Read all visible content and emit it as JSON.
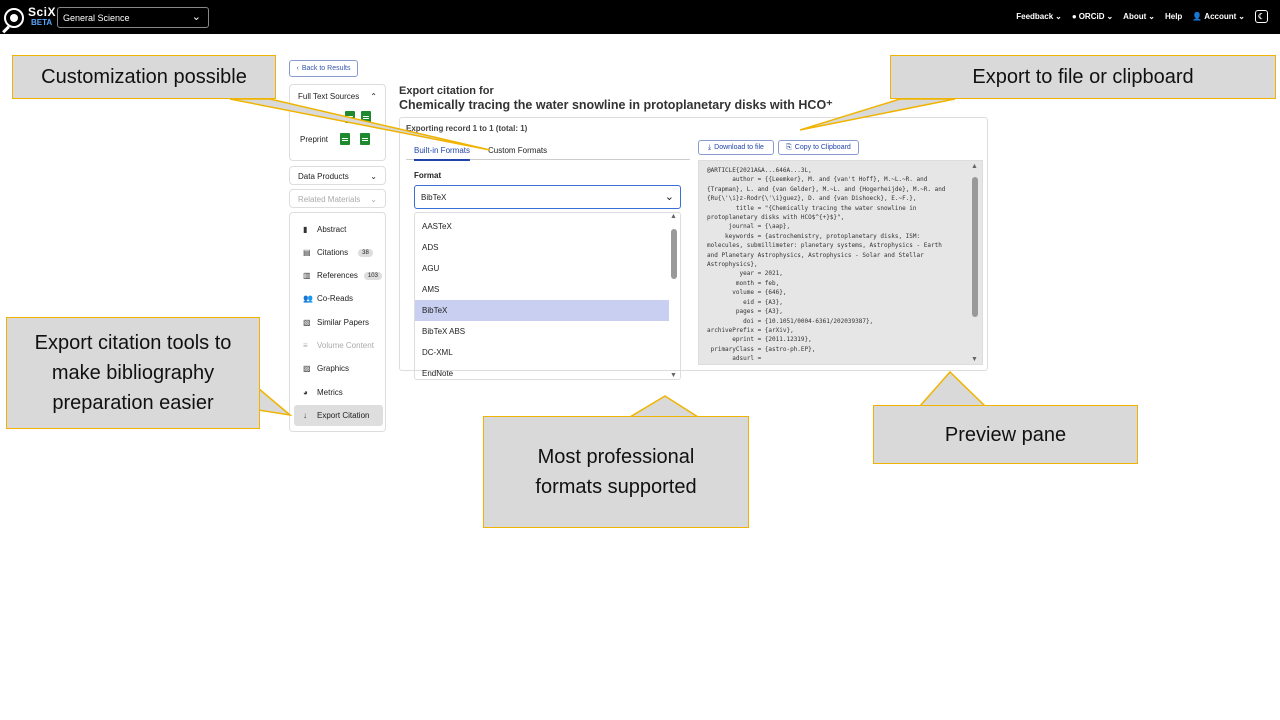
{
  "topbar": {
    "logo_text": "SciX",
    "logo_beta": "BETA",
    "discipline": "General Science",
    "nav": {
      "feedback": "Feedback",
      "orcid": "ORCiD",
      "about": "About",
      "help": "Help",
      "account": "Account"
    }
  },
  "sidebar": {
    "back_label": "Back to Results",
    "full_text_sources": "Full Text Sources",
    "preprint": "Preprint",
    "data_products": "Data Products",
    "related_materials": "Related Materials",
    "items": [
      {
        "label": "Abstract"
      },
      {
        "label": "Citations",
        "count": "38"
      },
      {
        "label": "References",
        "count": "103"
      },
      {
        "label": "Co-Reads"
      },
      {
        "label": "Similar Papers"
      },
      {
        "label": "Volume Content"
      },
      {
        "label": "Graphics"
      },
      {
        "label": "Metrics"
      },
      {
        "label": "Export Citation"
      }
    ]
  },
  "main": {
    "export_label": "Export citation for",
    "paper_title": "Chemically tracing the water snowline in protoplanetary disks with HCO⁺",
    "record_info": "Exporting record 1 to 1 (total: 1)",
    "tabs": [
      "Built-in Formats",
      "Custom Formats"
    ],
    "format_label": "Format",
    "selected_format": "BibTeX",
    "format_options": [
      "AASTeX",
      "ADS",
      "AGU",
      "AMS",
      "BibTeX",
      "BibTeX ABS",
      "DC-XML",
      "EndNote"
    ],
    "download_label": "Download to file",
    "copy_label": "Copy to Clipboard",
    "preview_text": "@ARTICLE{2021A&A...646A...3L,\n       author = {{Leemker}, M. and {van't Hoff}, M.~L.~R. and\n{Trapman}, L. and {van Gelder}, M.~L. and {Hogerheijde}, M.~R. and\n{Ru{\\'\\i}z-Rodr{\\'\\i}guez}, D. and {van Dishoeck}, E.~F.},\n        title = \"{Chemically tracing the water snowline in\nprotoplanetary disks with HCO$^{+}$}\",\n      journal = {\\aap},\n     keywords = {astrochemistry, protoplanetary disks, ISM:\nmolecules, submillimeter: planetary systems, Astrophysics - Earth\nand Planetary Astrophysics, Astrophysics - Solar and Stellar\nAstrophysics},\n         year = 2021,\n        month = feb,\n       volume = {646},\n          eid = {A3},\n        pages = {A3},\n          doi = {10.1051/0004-6361/202039387},\narchivePrefix = {arXiv},\n       eprint = {2011.12319},\n primaryClass = {astro-ph.EP},\n       adsurl ="
  },
  "callouts": {
    "customization": "Customization possible",
    "export_file": "Export to file or clipboard",
    "export_tools": "Export citation tools to make bibliography preparation easier",
    "formats": "Most professional formats supported",
    "preview": "Preview pane"
  },
  "colors": {
    "callout_border": "#f0b400",
    "callout_fill": "#d9d9d9",
    "accent": "#2244aa",
    "selected_option": "#c8cff0"
  }
}
